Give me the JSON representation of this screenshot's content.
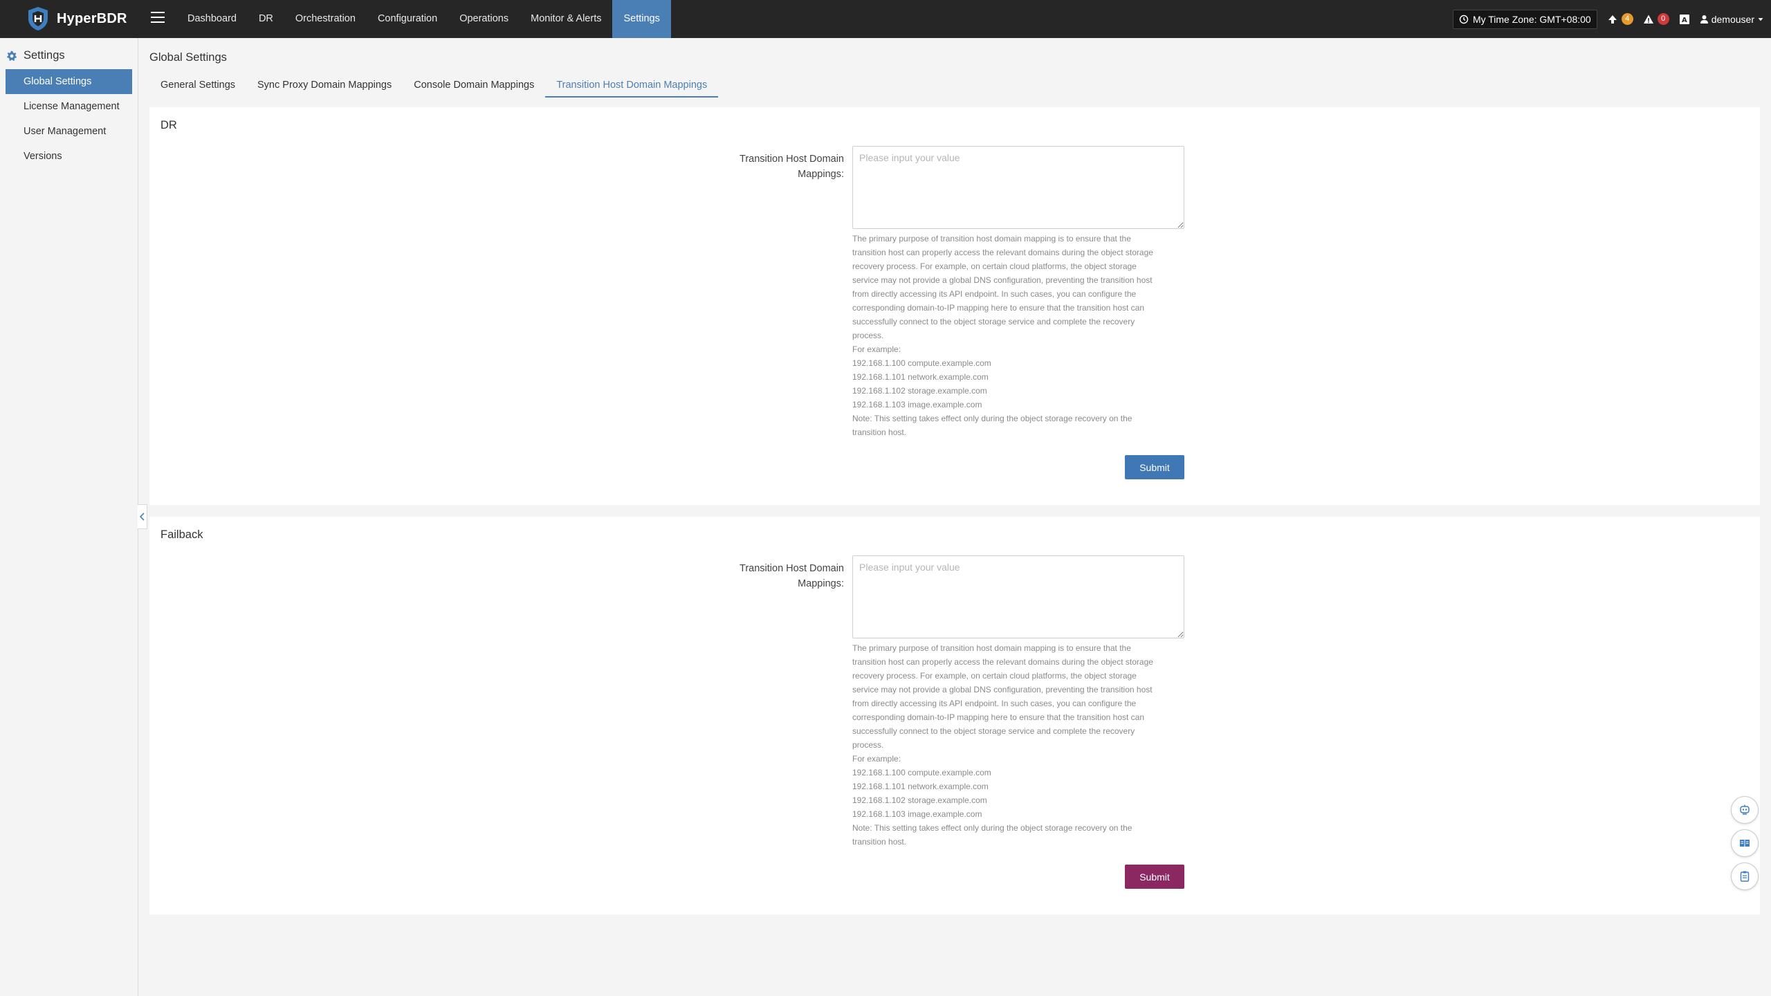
{
  "brand": {
    "name": "HyperBDR",
    "accent": "#4a7fb5"
  },
  "nav": {
    "items": [
      {
        "label": "Dashboard",
        "active": false
      },
      {
        "label": "DR",
        "active": false
      },
      {
        "label": "Orchestration",
        "active": false
      },
      {
        "label": "Configuration",
        "active": false
      },
      {
        "label": "Operations",
        "active": false
      },
      {
        "label": "Monitor & Alerts",
        "active": false
      },
      {
        "label": "Settings",
        "active": true
      }
    ]
  },
  "header": {
    "timezone": "My Time Zone: GMT+08:00",
    "upgrade_count": "4",
    "alert_count": "0",
    "username": "demouser"
  },
  "sidebar": {
    "title": "Settings",
    "items": [
      {
        "label": "Global Settings",
        "active": true
      },
      {
        "label": "License Management",
        "active": false
      },
      {
        "label": "User Management",
        "active": false
      },
      {
        "label": "Versions",
        "active": false
      }
    ]
  },
  "page": {
    "title": "Global Settings",
    "tabs": [
      {
        "label": "General Settings",
        "active": false
      },
      {
        "label": "Sync Proxy Domain Mappings",
        "active": false
      },
      {
        "label": "Console Domain Mappings",
        "active": false
      },
      {
        "label": "Transition Host Domain Mappings",
        "active": true
      }
    ]
  },
  "sections": [
    {
      "title": "DR",
      "field_label_line1": "Transition Host Domain",
      "field_label_line2": "Mappings:",
      "placeholder": "Please input your value",
      "help_lines": [
        "The primary purpose of transition host domain mapping is to ensure that the",
        "transition host can properly access the relevant domains during the object storage",
        "recovery process. For example, on certain cloud platforms, the object storage",
        "service may not provide a global DNS configuration, preventing the transition host",
        "from directly accessing its API endpoint. In such cases, you can configure the",
        "corresponding domain-to-IP mapping here to ensure that the transition host can",
        "successfully connect to the object storage service and complete the recovery",
        "process.",
        "For example:",
        "192.168.1.100 compute.example.com",
        "192.168.1.101 network.example.com",
        "192.168.1.102 storage.example.com",
        "192.168.1.103 image.example.com",
        "Note: This setting takes effect only during the object storage recovery on the",
        "transition host."
      ],
      "submit_label": "Submit",
      "submit_color": "#3f78b5"
    },
    {
      "title": "Failback",
      "field_label_line1": "Transition Host Domain",
      "field_label_line2": "Mappings:",
      "placeholder": "Please input your value",
      "help_lines": [
        "The primary purpose of transition host domain mapping is to ensure that the",
        "transition host can properly access the relevant domains during the object storage",
        "recovery process. For example, on certain cloud platforms, the object storage",
        "service may not provide a global DNS configuration, preventing the transition host",
        "from directly accessing its API endpoint. In such cases, you can configure the",
        "corresponding domain-to-IP mapping here to ensure that the transition host can",
        "successfully connect to the object storage service and complete the recovery",
        "process.",
        "For example:",
        "192.168.1.100 compute.example.com",
        "192.168.1.101 network.example.com",
        "192.168.1.102 storage.example.com",
        "192.168.1.103 image.example.com",
        "Note: This setting takes effect only during the object storage recovery on the",
        "transition host."
      ],
      "submit_label": "Submit",
      "submit_color": "#8c2861"
    }
  ],
  "floating_buttons": [
    {
      "icon": "robot-icon"
    },
    {
      "icon": "book-icon"
    },
    {
      "icon": "clipboard-icon"
    }
  ]
}
